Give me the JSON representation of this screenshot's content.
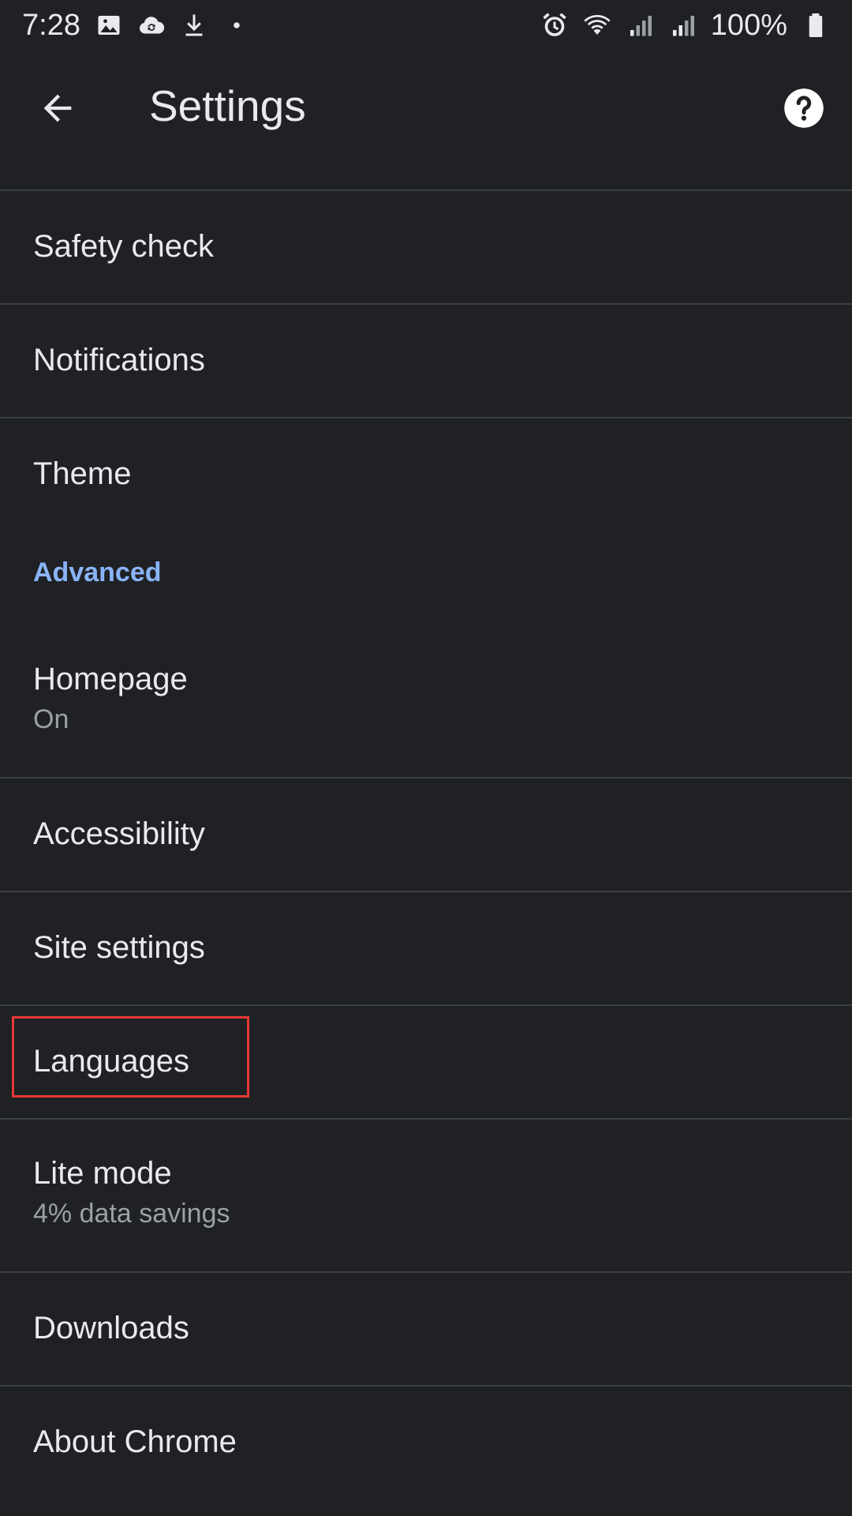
{
  "status_bar": {
    "time": "7:28",
    "battery": "100%",
    "left_icons": [
      "image-icon",
      "cloud-sync-icon",
      "download-icon",
      "dot-icon"
    ],
    "right_icons": [
      "alarm-icon",
      "wifi-icon",
      "signal-icon",
      "signal-icon",
      "battery-icon"
    ]
  },
  "app_bar": {
    "title": "Settings",
    "back_icon": "arrow-back-icon",
    "help_icon": "help-icon"
  },
  "settings": {
    "safety_check": "Safety check",
    "notifications": "Notifications",
    "theme": "Theme",
    "advanced_header": "Advanced",
    "homepage": {
      "title": "Homepage",
      "subtitle": "On"
    },
    "accessibility": "Accessibility",
    "site_settings": "Site settings",
    "languages": "Languages",
    "lite_mode": {
      "title": "Lite mode",
      "subtitle": "4% data savings"
    },
    "downloads": "Downloads",
    "about_chrome": "About Chrome"
  },
  "colors": {
    "background": "#202124",
    "text": "#e8eaed",
    "secondary_text": "#9aa0a6",
    "accent": "#8ab4f8",
    "divider": "#3c4043",
    "highlight": "#e53935"
  }
}
